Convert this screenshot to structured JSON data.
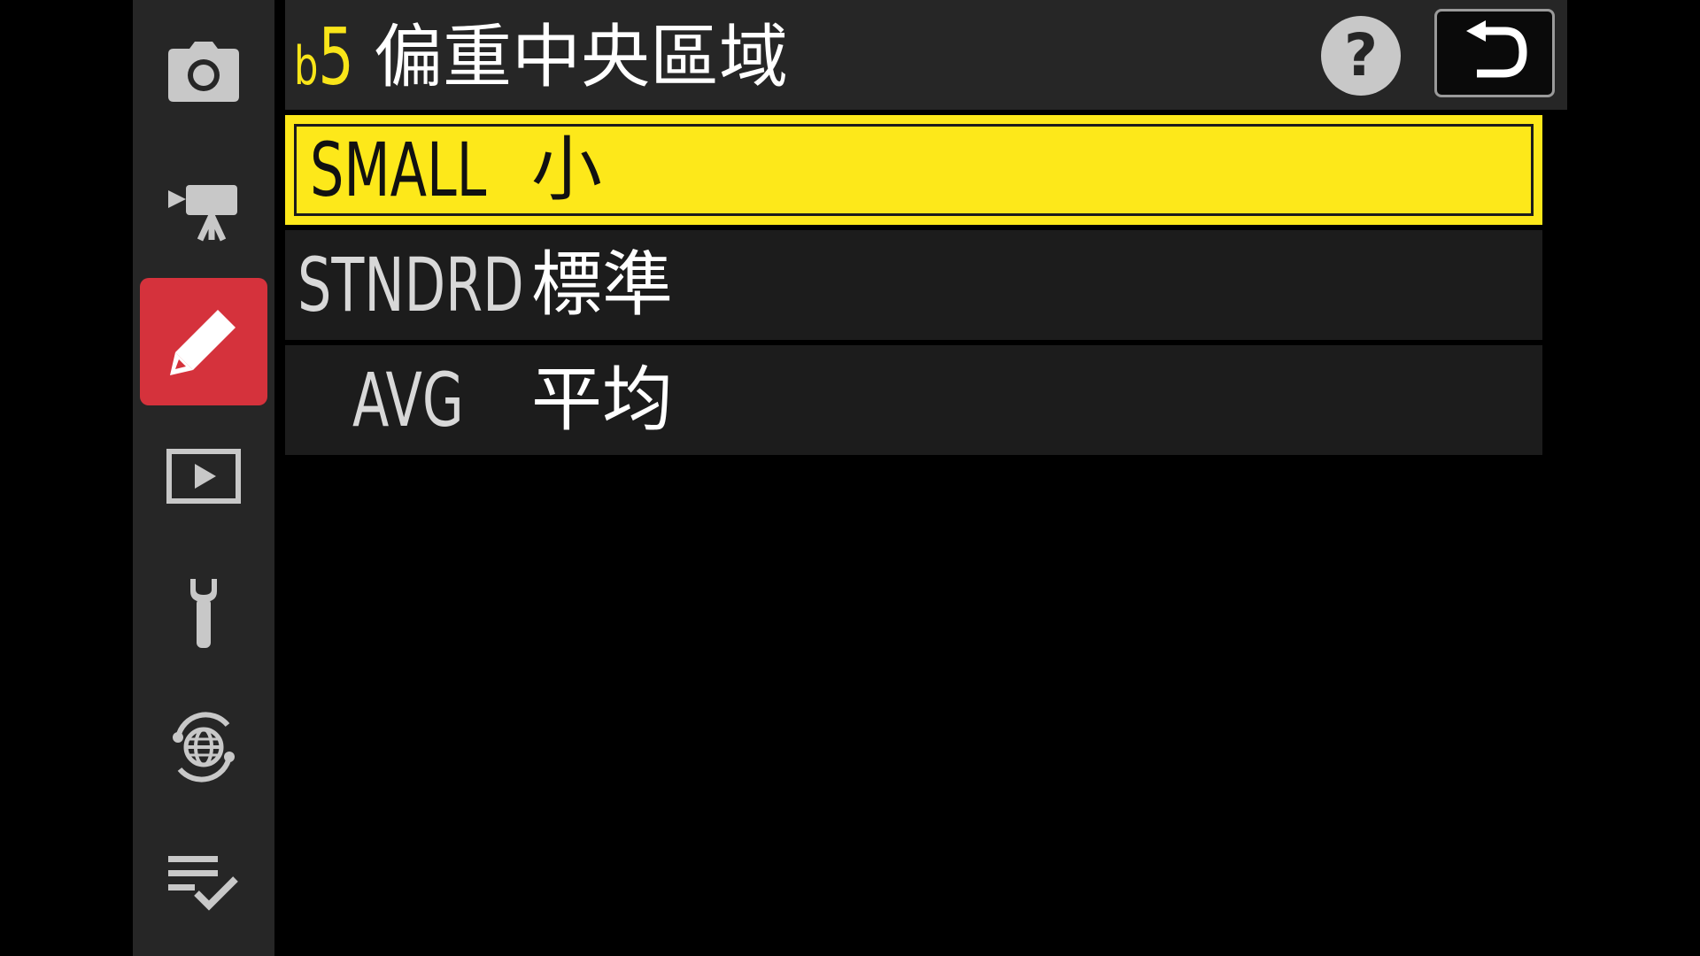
{
  "header": {
    "code_letter": "b",
    "code_number": "5",
    "title": "偏重中央區域",
    "help_label": "?"
  },
  "sidebar": {
    "items": [
      {
        "icon": "camera-icon",
        "active": false
      },
      {
        "icon": "movie-camera-icon",
        "active": false
      },
      {
        "icon": "pencil-icon",
        "active": true
      },
      {
        "icon": "playback-icon",
        "active": false
      },
      {
        "icon": "wrench-icon",
        "active": false
      },
      {
        "icon": "network-globe-icon",
        "active": false
      },
      {
        "icon": "my-menu-checklist-icon",
        "active": false
      }
    ]
  },
  "options": [
    {
      "code": "SMALL",
      "label": "小",
      "selected": true
    },
    {
      "code": "STNDRD",
      "label": "標準",
      "selected": false
    },
    {
      "code": "AVG",
      "label": "平均",
      "selected": false
    }
  ],
  "colors": {
    "accent_yellow": "#fde81a",
    "active_red": "#d5323c",
    "panel": "#262626",
    "row": "#1c1c1c"
  }
}
